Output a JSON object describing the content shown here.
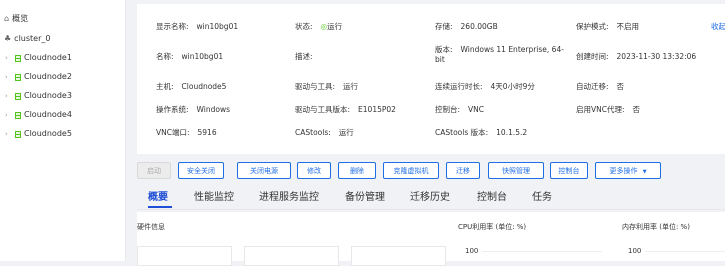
{
  "sidebar": {
    "overview": "概览",
    "cluster": "cluster_0",
    "nodes": [
      "Cloudnode1",
      "Cloudnode2",
      "Cloudnode3",
      "Cloudnode4",
      "Cloudnode5"
    ]
  },
  "info": {
    "display_name_k": "显示名称:",
    "display_name_v": "win10bg01",
    "status_k": "状态:",
    "status_v": "运行",
    "storage_k": "存储:",
    "storage_v": "260.00GB",
    "protect_k": "保护模式:",
    "protect_v": "不启用",
    "name_k": "名称:",
    "name_v": "win10bg01",
    "desc_k": "描述:",
    "version_k": "版本:",
    "version_v": "Windows 11 Enterprise, 64-bit",
    "created_k": "创建时间:",
    "created_v": "2023-11-30 13:32:06",
    "host_k": "主机:",
    "host_v": "Cloudnode5",
    "driver_k": "驱动与工具:",
    "driver_v": "运行",
    "uptime_k": "连续运行时长:",
    "uptime_v": "4天0小时9分",
    "automig_k": "自动迁移:",
    "automig_v": "否",
    "os_k": "操作系统:",
    "os_v": "Windows",
    "drv_ver_k": "驱动与工具版本:",
    "drv_ver_v": "E1015P02",
    "console_k": "控制台:",
    "console_v": "VNC",
    "vncctrl_k": "启用VNC代理:",
    "vncctrl_v": "否",
    "vnc_k": "VNC端口:",
    "vnc_v": "5916",
    "castools_k": "CAStools:",
    "castools_v": "运行",
    "castools_ver_k": "CAStools 版本:",
    "castools_ver_v": "10.1.5.2",
    "more": "收起"
  },
  "buttons": [
    "启动",
    "安全关闭",
    "关闭电源",
    "修改",
    "删除",
    "克隆虚拟机",
    "迁移",
    "快照管理",
    "控制台",
    "更多操作"
  ],
  "tabs": [
    "概要",
    "性能监控",
    "进程服务监控",
    "备份管理",
    "迁移历史",
    "控制台",
    "任务"
  ],
  "bottom": {
    "hw_title": "硬件信息",
    "cpu_title": "CPU利用率 (单位: %)",
    "mem_title": "内存利用率 (单位: %)",
    "cpu_axis_max": "100",
    "mem_axis_max": "100"
  },
  "colors": {
    "accent": "#1f6ee6",
    "tab_active": "#1f4fd6",
    "status_ok": "#52c41a"
  }
}
